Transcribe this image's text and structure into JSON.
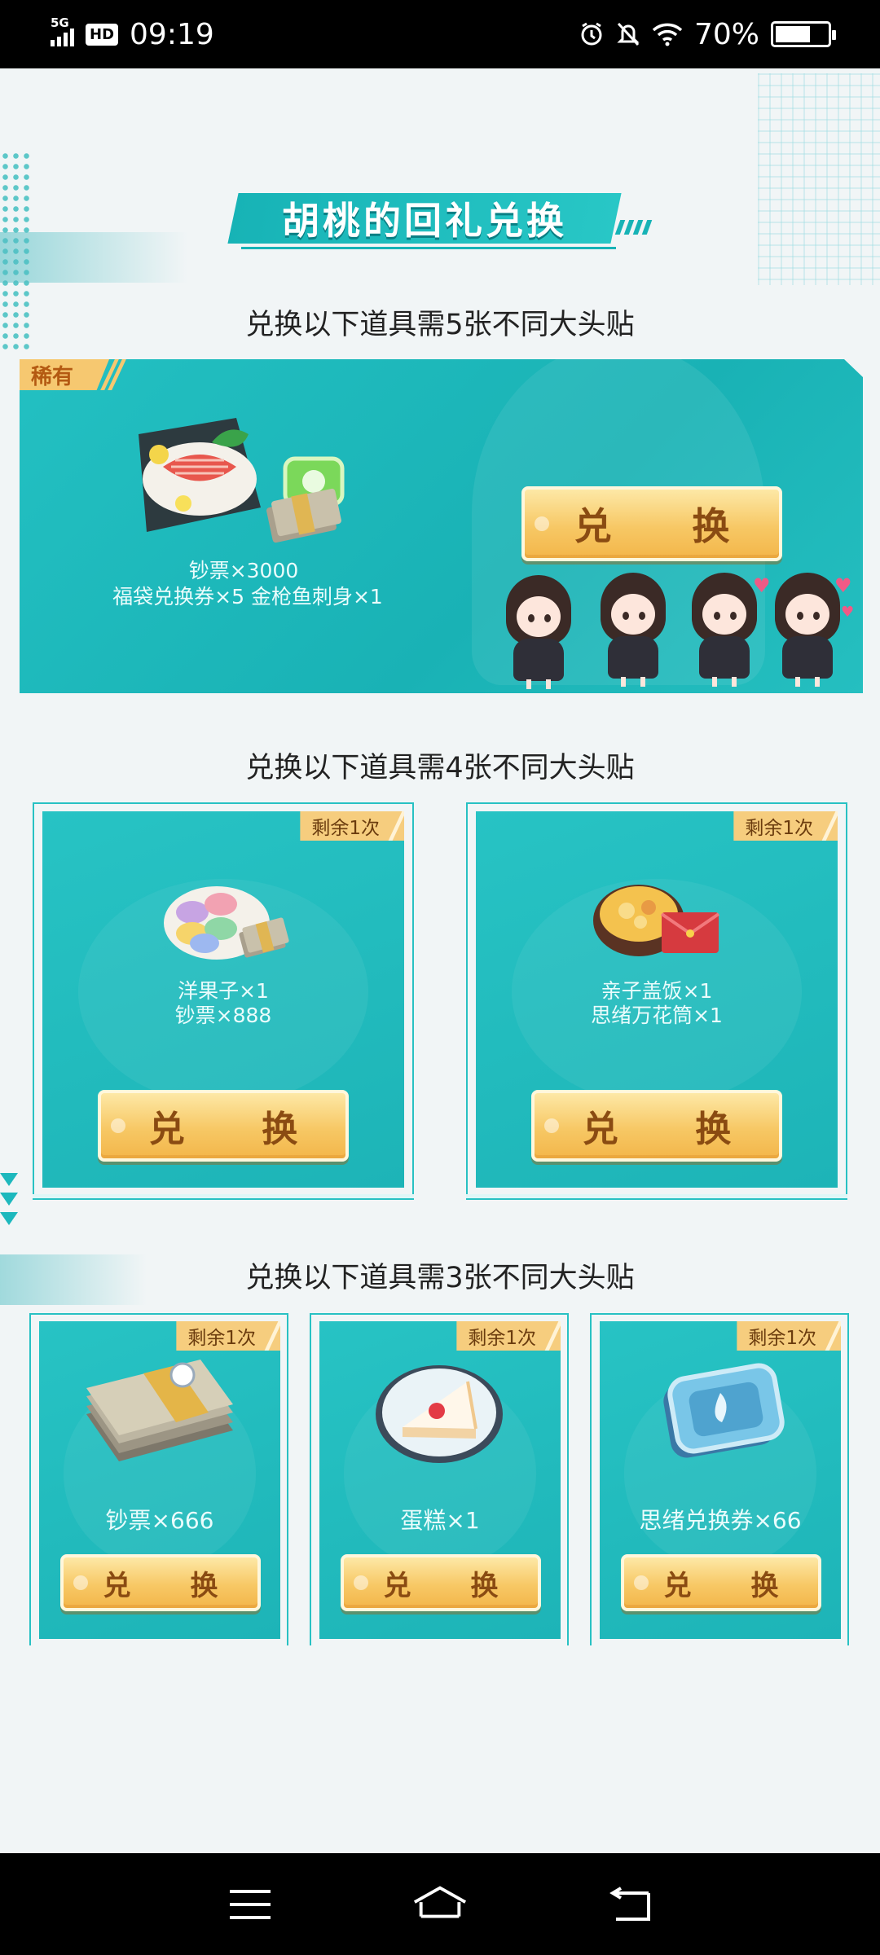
{
  "status_bar": {
    "network": "5G",
    "hd": "HD",
    "time": "09:19",
    "battery": "70%",
    "icons": [
      "alarm-icon",
      "mute-icon",
      "wifi-icon",
      "battery-icon"
    ]
  },
  "page": {
    "title": "胡桃的回礼兑换",
    "accent_color": "#1db4b7",
    "button_color": "#f7c865"
  },
  "section1": {
    "heading": "兑换以下道具需5张不同大头贴",
    "card": {
      "tag": "稀有",
      "reward_line1": "钞票×3000",
      "reward_line2": "福袋兑换券×5   金枪鱼刺身×1",
      "button_label": "兑 换"
    }
  },
  "section2": {
    "heading": "兑换以下道具需4张不同大头贴",
    "cards": [
      {
        "remain": "剩余1次",
        "line1": "洋果子×1",
        "line2": "钞票×888",
        "button_label": "兑 换"
      },
      {
        "remain": "剩余1次",
        "line1": "亲子盖饭×1",
        "line2": "思绪万花筒×1",
        "button_label": "兑 换"
      }
    ]
  },
  "section3": {
    "heading": "兑换以下道具需3张不同大头贴",
    "cards": [
      {
        "remain": "剩余1次",
        "line1": "钞票×666",
        "button_label": "兑 换"
      },
      {
        "remain": "剩余1次",
        "line1": "蛋糕×1",
        "button_label": "兑 换"
      },
      {
        "remain": "剩余1次",
        "line1": "思绪兑换券×66",
        "button_label": "兑 换"
      }
    ]
  },
  "nav_bar": {
    "buttons": [
      "menu-icon",
      "home-icon",
      "back-icon"
    ]
  }
}
